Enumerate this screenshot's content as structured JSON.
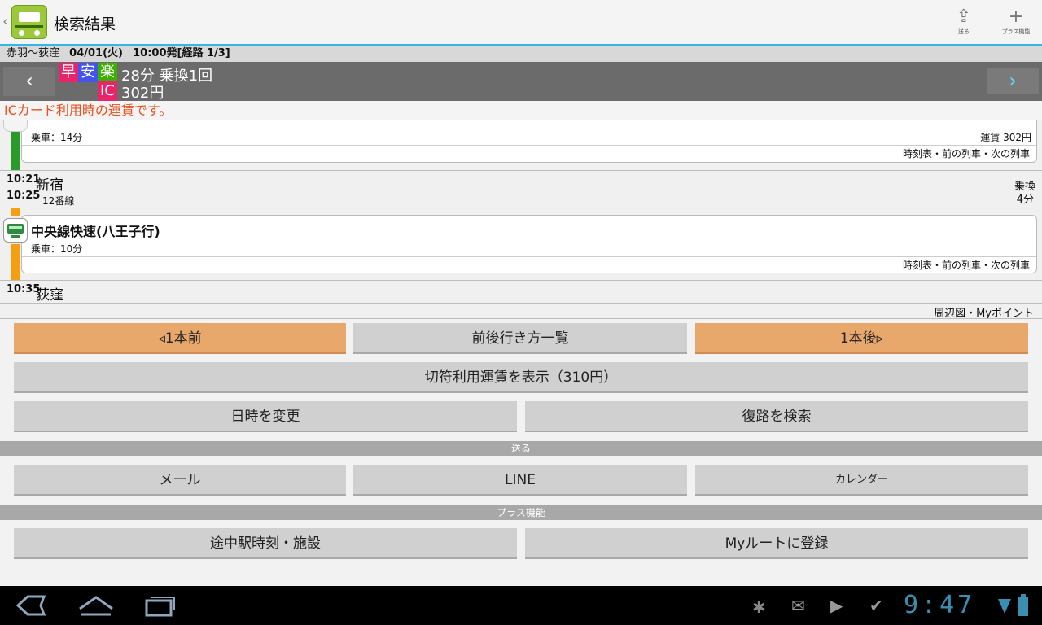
{
  "header": {
    "title": "検索結果",
    "share_label": "送る",
    "plus_label": "プラス機能"
  },
  "route": {
    "stations": "赤羽〜荻窪",
    "date": "04/01(火)",
    "depart": "10:00発[経路 1/3]"
  },
  "summary": {
    "badges": [
      "早",
      "安",
      "楽",
      "IC"
    ],
    "duration": "28分 乗換1回",
    "fare": "302円",
    "notice": "ICカード利用時の運賃です。"
  },
  "segments": {
    "seg1": {
      "ride": "乗車：14分",
      "fare": "運賃 302円",
      "links": "時刻表・前の列車・次の列車"
    },
    "transfer": {
      "arrive": "10:21",
      "depart": "10:25",
      "station": "新宿",
      "platform": "12番線",
      "label": "乗換",
      "minutes": "4分"
    },
    "seg2": {
      "line": "中央線快速(八王子行)",
      "ride": "乗車：10分",
      "links": "時刻表・前の列車・次の列車"
    },
    "dest": {
      "time": "10:35",
      "station": "荻窪"
    },
    "map_link": "周辺図・Myポイント"
  },
  "buttons": {
    "prev": "◃1本前",
    "list": "前後行き方一覧",
    "next": "1本後▹",
    "ticket_fare": "切符利用運賃を表示（310円）",
    "change_time": "日時を変更",
    "return_route": "復路を検索",
    "section_send": "送る",
    "mail": "メール",
    "line": "LINE",
    "calendar": "カレンダー",
    "section_plus": "プラス機能",
    "midway": "途中駅時刻・施設",
    "my_route": "Myルートに登録"
  },
  "system": {
    "clock": "9:47"
  },
  "colors": {
    "accent": "#36b6e6",
    "orange_button": "#e8a76b",
    "notice_text": "#e8501c",
    "green_line": "#2a9a2a",
    "orange_line": "#f4a012"
  }
}
